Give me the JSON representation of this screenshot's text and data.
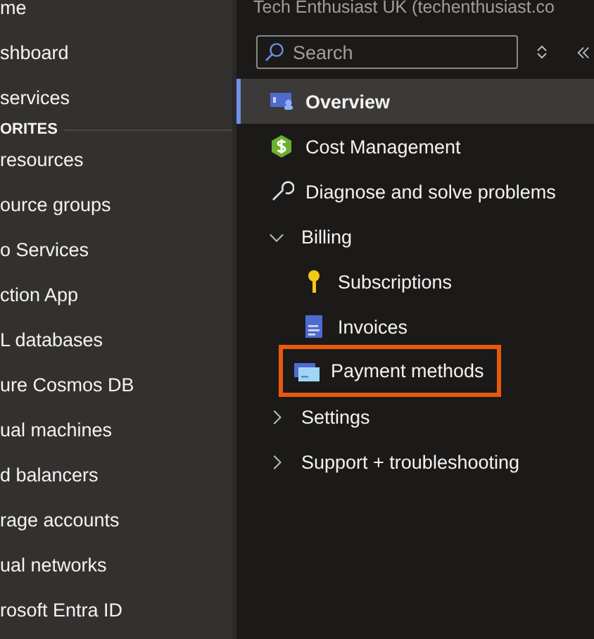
{
  "left_nav": {
    "items": [
      {
        "kind": "item",
        "label": "me"
      },
      {
        "kind": "item",
        "label": "shboard"
      },
      {
        "kind": "item",
        "label": "services"
      },
      {
        "kind": "section",
        "label": "ORITES"
      },
      {
        "kind": "item",
        "label": "resources"
      },
      {
        "kind": "item",
        "label": "ource groups"
      },
      {
        "kind": "item",
        "label": "o Services"
      },
      {
        "kind": "item",
        "label": "ction App"
      },
      {
        "kind": "item",
        "label": "L databases"
      },
      {
        "kind": "item",
        "label": "ure Cosmos DB"
      },
      {
        "kind": "item",
        "label": "ual machines"
      },
      {
        "kind": "item",
        "label": "d balancers"
      },
      {
        "kind": "item",
        "label": "rage accounts"
      },
      {
        "kind": "item",
        "label": "ual networks"
      },
      {
        "kind": "item",
        "label": "rosoft Entra ID"
      }
    ]
  },
  "blade": {
    "subtitle": "Tech Enthusiast UK (techenthusiast.co",
    "search": {
      "placeholder": "Search"
    },
    "menu": [
      {
        "kind": "link",
        "label": "Overview",
        "selected": true,
        "highlighted": false
      },
      {
        "kind": "link",
        "label": "Cost Management",
        "selected": false,
        "highlighted": false
      },
      {
        "kind": "link",
        "label": "Diagnose and solve problems",
        "selected": false,
        "highlighted": false
      },
      {
        "kind": "group",
        "label": "Billing",
        "expanded": true,
        "selected": false,
        "highlighted": false,
        "children": [
          {
            "kind": "link",
            "label": "Subscriptions",
            "selected": false,
            "highlighted": false
          },
          {
            "kind": "link",
            "label": "Invoices",
            "selected": false,
            "highlighted": false
          },
          {
            "kind": "link",
            "label": "Payment methods",
            "selected": false,
            "highlighted": true
          }
        ]
      },
      {
        "kind": "group",
        "label": "Settings",
        "expanded": false,
        "selected": false,
        "highlighted": false
      },
      {
        "kind": "group",
        "label": "Support + troubleshooting",
        "expanded": false,
        "selected": false,
        "highlighted": false
      }
    ]
  }
}
